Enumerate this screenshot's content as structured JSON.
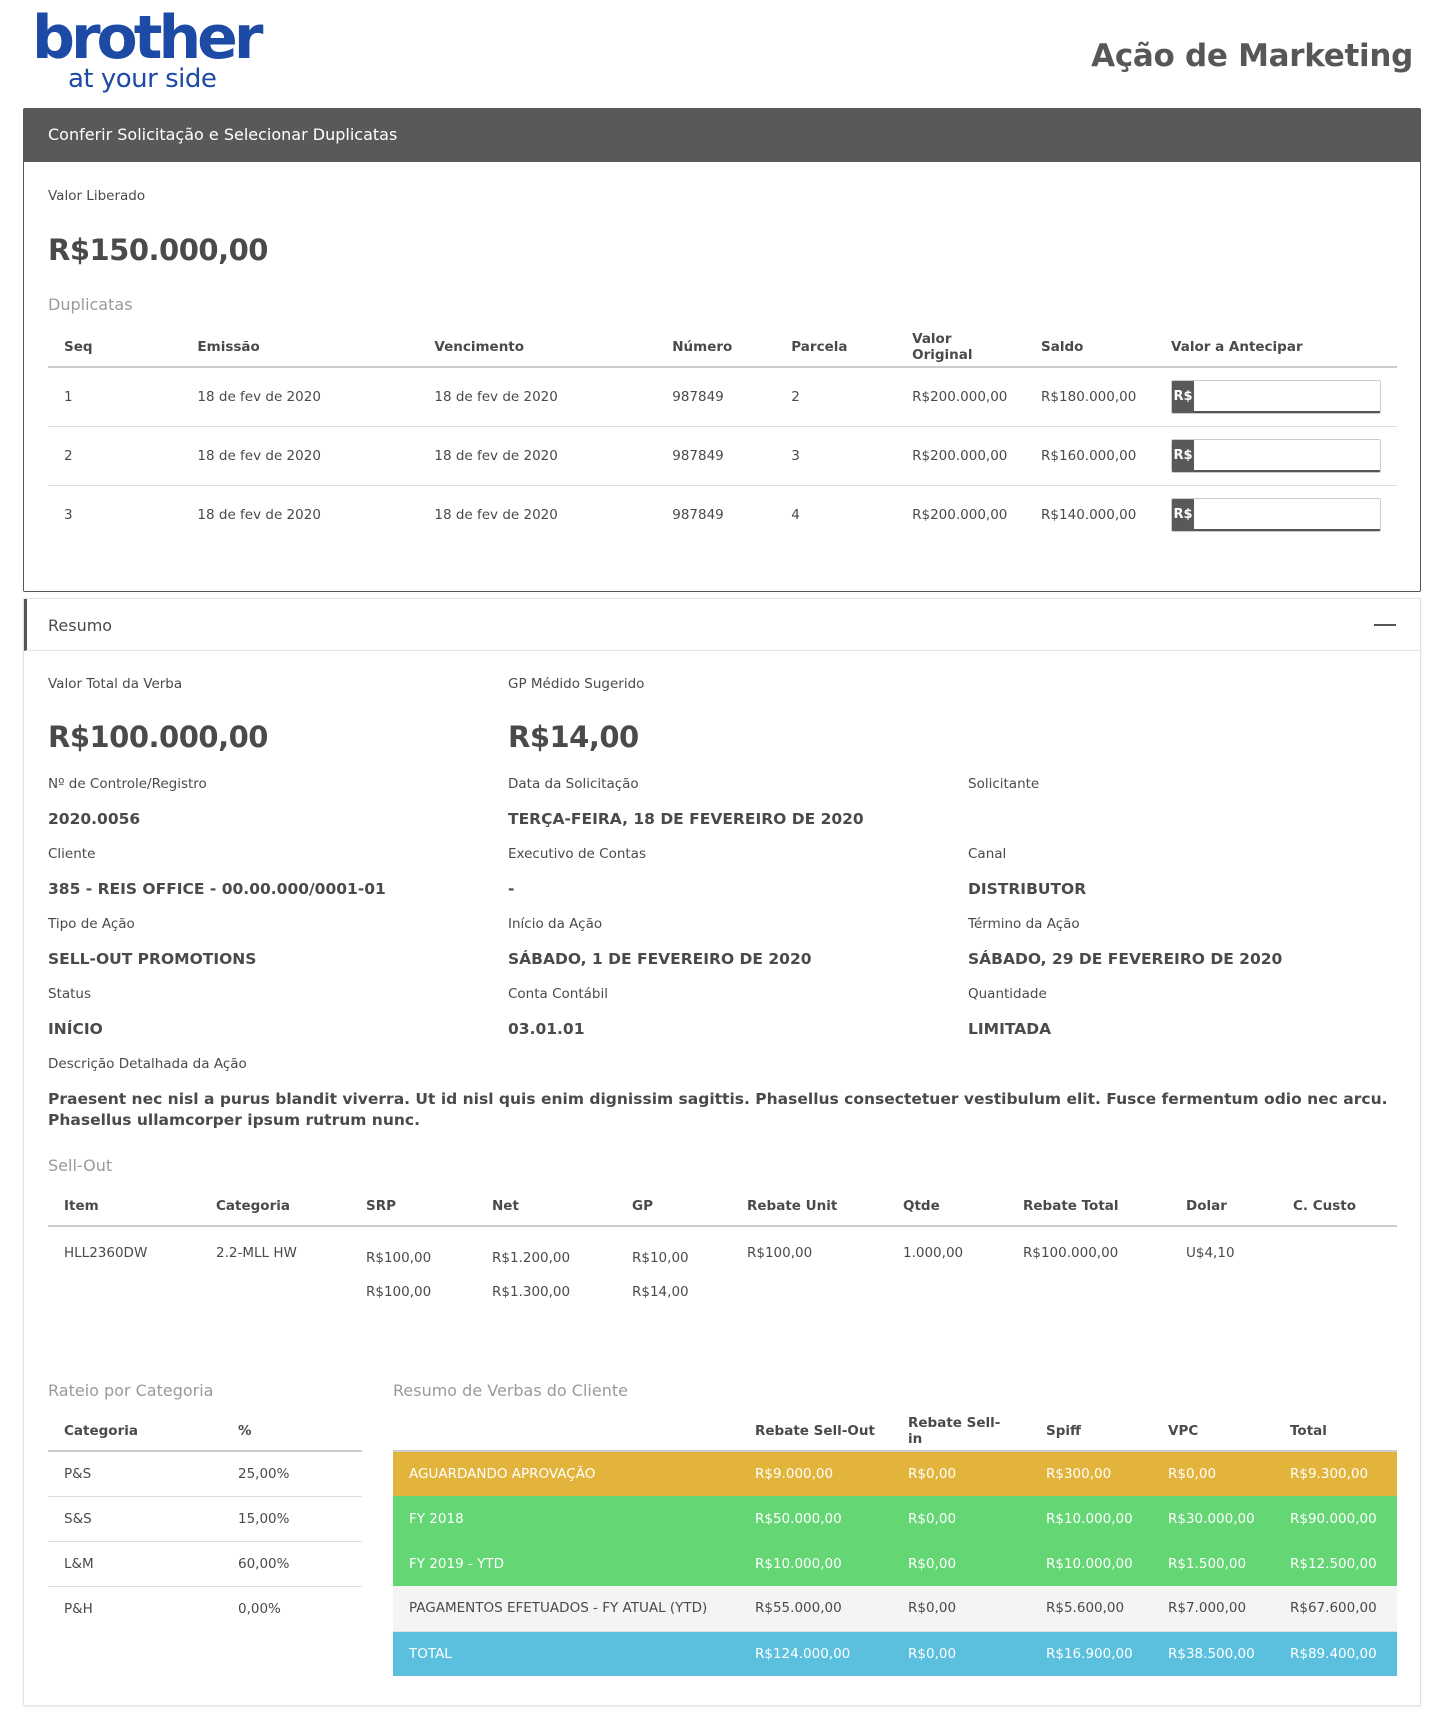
{
  "brand": {
    "name": "brother",
    "tagline": "at your side",
    "color": "#1c4aa4"
  },
  "page_title": "Ação de Marketing",
  "panel1": {
    "title": "Conferir Solicitação e Selecionar Duplicatas",
    "valor_liberado_label": "Valor Liberado",
    "valor_liberado": "R$150.000,00",
    "duplicatas_title": "Duplicatas",
    "columns": [
      "Seq",
      "Emissão",
      "Vencimento",
      "Número",
      "Parcela",
      "Valor Original",
      "Saldo",
      "Valor a Antecipar"
    ],
    "rows": [
      {
        "seq": "1",
        "emissao": "18 de fev de 2020",
        "vencimento": "18 de fev de 2020",
        "numero": "987849",
        "parcela": "2",
        "valor_original": "R$200.000,00",
        "saldo": "R$180.000,00",
        "addon": "R$",
        "value": ""
      },
      {
        "seq": "2",
        "emissao": "18 de fev de 2020",
        "vencimento": "18 de fev de 2020",
        "numero": "987849",
        "parcela": "3",
        "valor_original": "R$200.000,00",
        "saldo": "R$160.000,00",
        "addon": "R$",
        "value": ""
      },
      {
        "seq": "3",
        "emissao": "18 de fev de 2020",
        "vencimento": "18 de fev de 2020",
        "numero": "987849",
        "parcela": "4",
        "valor_original": "R$200.000,00",
        "saldo": "R$140.000,00",
        "addon": "R$",
        "value": ""
      }
    ]
  },
  "resumo": {
    "title": "Resumo",
    "valor_total_label": "Valor Total da Verba",
    "valor_total": "R$100.000,00",
    "gp_label": "GP Médido Sugerido",
    "gp_value": "R$14,00",
    "fields": {
      "controle_label": "Nº de Controle/Registro",
      "controle": "2020.0056",
      "data_label": "Data da Solicitação",
      "data": "TERÇA-FEIRA, 18 DE FEVEREIRO DE 2020",
      "solicitante_label": "Solicitante",
      "solicitante": "",
      "cliente_label": "Cliente",
      "cliente": "385 - REIS OFFICE - 00.00.000/0001-01",
      "executivo_label": "Executivo de Contas",
      "executivo": "-",
      "canal_label": "Canal",
      "canal": "DISTRIBUTOR",
      "tipo_label": "Tipo de Ação",
      "tipo": "SELL-OUT PROMOTIONS",
      "inicio_label": "Início da Ação",
      "inicio": "SÁBADO, 1 DE FEVEREIRO DE 2020",
      "termino_label": "Término da Ação",
      "termino": "SÁBADO, 29 DE FEVEREIRO DE 2020",
      "status_label": "Status",
      "status": "INÍCIO",
      "conta_label": "Conta Contábil",
      "conta": "03.01.01",
      "quantidade_label": "Quantidade",
      "quantidade": "LIMITADA",
      "descricao_label": "Descrição Detalhada da Ação",
      "descricao": "Praesent nec nisl a purus blandit viverra. Ut id nisl quis enim dignissim sagittis. Phasellus consectetuer vestibulum elit. Fusce fermentum odio nec arcu. Phasellus ullamcorper ipsum rutrum nunc."
    },
    "sellout": {
      "title": "Sell-Out",
      "columns": [
        "Item",
        "Categoria",
        "SRP",
        "Net",
        "GP",
        "Rebate Unit",
        "Qtde",
        "Rebate Total",
        "Dolar",
        "C. Custo"
      ],
      "row": {
        "item": "HLL2360DW",
        "categoria": "2.2-MLL HW",
        "srp": [
          "R$100,00",
          "R$100,00"
        ],
        "net": [
          "R$1.200,00",
          "R$1.300,00"
        ],
        "gp": [
          "R$10,00",
          "R$14,00"
        ],
        "rebate_unit": "R$100,00",
        "qtde": "1.000,00",
        "rebate_total": "R$100.000,00",
        "dolar": "U$4,10",
        "c_custo": ""
      }
    },
    "rateio": {
      "title": "Rateio por Categoria",
      "columns": [
        "Categoria",
        "%"
      ],
      "rows": [
        {
          "categoria": "P&S",
          "pct": "25,00%"
        },
        {
          "categoria": "S&S",
          "pct": "15,00%"
        },
        {
          "categoria": "L&M",
          "pct": "60,00%"
        },
        {
          "categoria": "P&H",
          "pct": "0,00%"
        }
      ]
    },
    "verbas": {
      "title": "Resumo de Verbas do Cliente",
      "columns": [
        "",
        "Rebate Sell-Out",
        "Rebate Sell-in",
        "Spiff",
        "VPC",
        "Total"
      ],
      "colors": {
        "aguardando": "#e2b43c",
        "fy": "#64d674",
        "pagamentos": "#f4f4f4",
        "total": "#5bc0de"
      },
      "rows": [
        {
          "label": "AGUARDANDO APROVAÇÃO",
          "sellout": "R$9.000,00",
          "sellin": "R$0,00",
          "spiff": "R$300,00",
          "vpc": "R$0,00",
          "total": "R$9.300,00"
        },
        {
          "label": "FY 2018",
          "sellout": "R$50.000,00",
          "sellin": "R$0,00",
          "spiff": "R$10.000,00",
          "vpc": "R$30.000,00",
          "total": "R$90.000,00"
        },
        {
          "label": "FY 2019 - YTD",
          "sellout": "R$10.000,00",
          "sellin": "R$0,00",
          "spiff": "R$10.000,00",
          "vpc": "R$1.500,00",
          "total": "R$12.500,00"
        },
        {
          "label": "PAGAMENTOS EFETUADOS - FY ATUAL (YTD)",
          "sellout": "R$55.000,00",
          "sellin": "R$0,00",
          "spiff": "R$5.600,00",
          "vpc": "R$7.000,00",
          "total": "R$67.600,00"
        },
        {
          "label": "TOTAL",
          "sellout": "R$124.000,00",
          "sellin": "R$0,00",
          "spiff": "R$16.900,00",
          "vpc": "R$38.500,00",
          "total": "R$89.400,00"
        }
      ]
    }
  }
}
